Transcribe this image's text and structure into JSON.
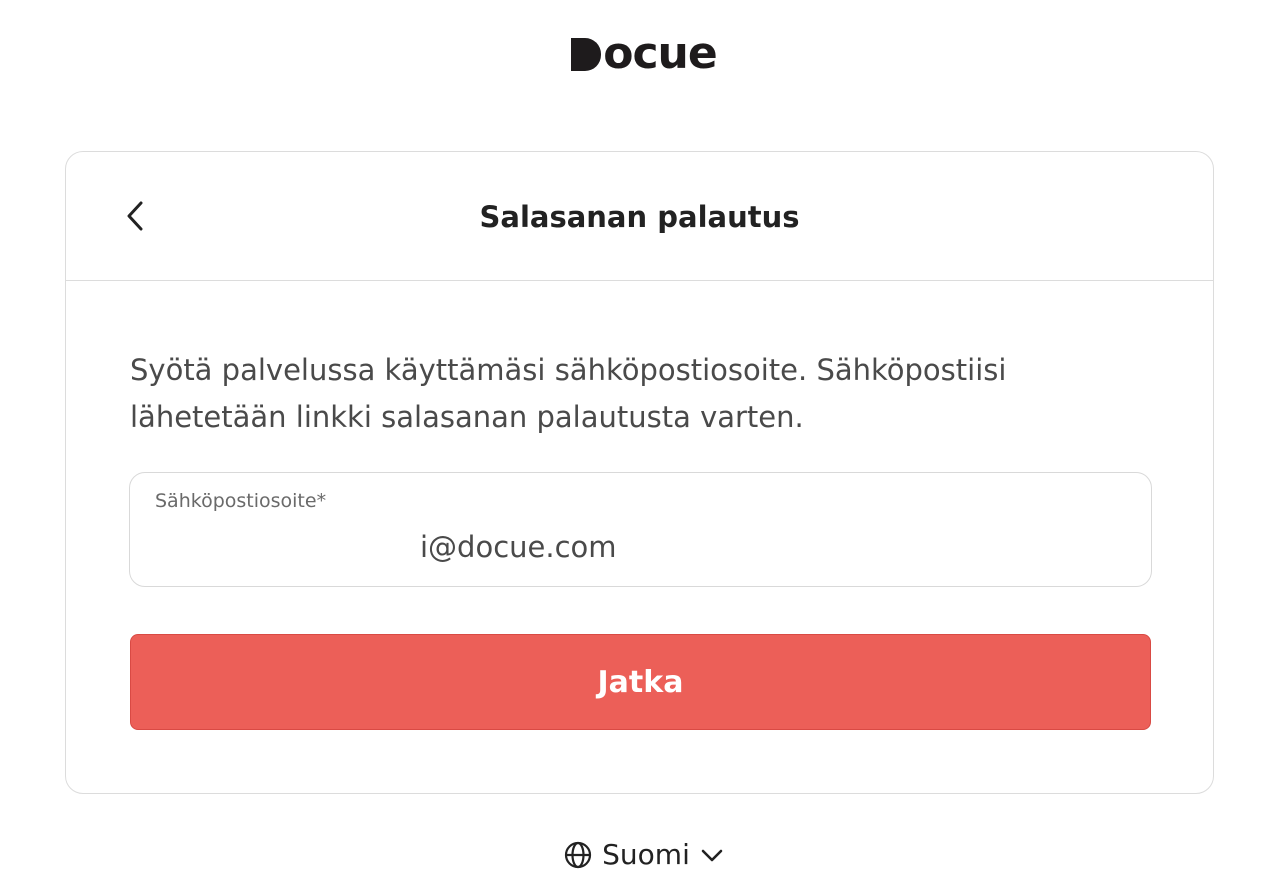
{
  "logo": {
    "text": "ocue",
    "icon": "logo-d-mark"
  },
  "card": {
    "title": "Salasanan palautus",
    "back_icon": "chevron-left-icon",
    "description": "Syötä palvelussa käyttämäsi sähköpostiosoite. Sähköpostiisi lähetetään linkki salasanan palautusta varten.",
    "email_field": {
      "label": "Sähköpostiosoite*",
      "value": "i@docue.com"
    },
    "submit_label": "Jatka"
  },
  "language": {
    "label": "Suomi",
    "globe_icon": "globe-icon",
    "chevron_icon": "chevron-down-icon"
  },
  "colors": {
    "accent": "#ec5f58",
    "text": "#222222",
    "muted": "#4a4a4a",
    "border": "#dcdcdc"
  }
}
